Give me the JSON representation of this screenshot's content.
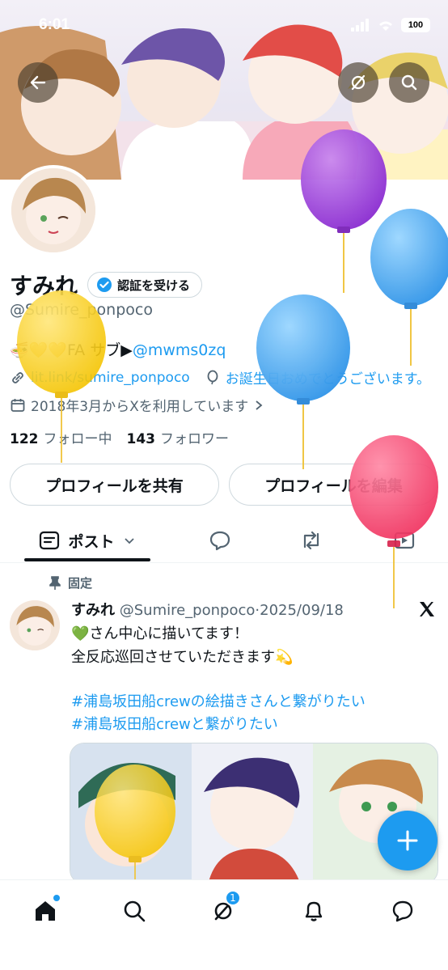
{
  "status_bar": {
    "time": "6:01",
    "battery": "100"
  },
  "profile": {
    "display_name": "すみれ",
    "verify_label": "認証を受ける",
    "handle": "@Sumire_ponpoco",
    "bio_prefix": "🍜💛💛FA サブ▶",
    "bio_mention": "@mwms0zq",
    "website": "lit.link/sumire_ponpoco",
    "birthday": "お誕生日おめでとうございます。",
    "joined": "2018年3月からXを利用しています",
    "following_count": "122",
    "following_label": "フォロー中",
    "followers_count": "143",
    "followers_label": "フォロワー"
  },
  "actions": {
    "share_label": "プロフィールを共有",
    "edit_label": "プロフィールを編集"
  },
  "tabs": {
    "posts_label": "ポスト"
  },
  "pinned_post": {
    "pinned_label": "固定",
    "author": "すみれ",
    "handle": "@Sumire_ponpoco",
    "separator": "·",
    "date": "2025/09/18",
    "line1": "💚さん中心に描いてます！",
    "line2": "全反応巡回させていただきます💫",
    "hashtag1": "#浦島坂田船crewの絵描きさんと繋がりたい",
    "hashtag2": "#浦島坂田船crewと繋がりたい"
  },
  "bottom_nav": {
    "notification_badge": "1"
  },
  "colors": {
    "accent": "#1d9bf0",
    "text": "#0f1419",
    "secondary": "#536471"
  }
}
